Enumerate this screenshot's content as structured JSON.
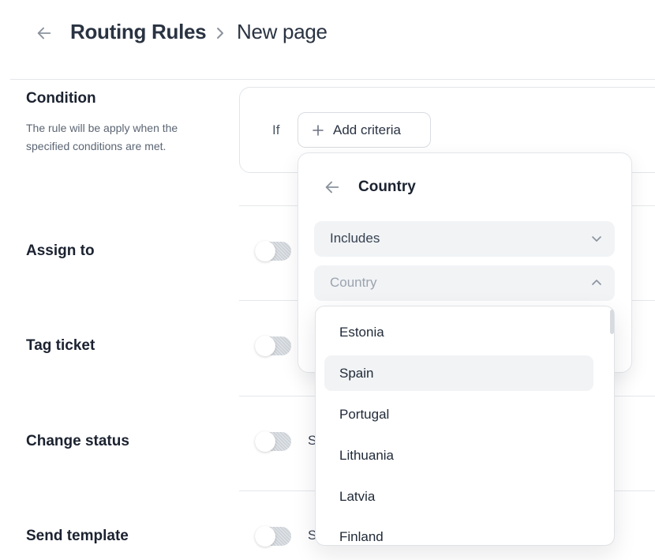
{
  "header": {
    "breadcrumb_root": "Routing Rules",
    "breadcrumb_current": "New page"
  },
  "condition": {
    "title": "Condition",
    "description": "The rule will be apply when the specified conditions are met.",
    "if_label": "If",
    "add_criteria_label": "Add criteria"
  },
  "rows": {
    "assign_to": {
      "label": "Assign to"
    },
    "tag_ticket": {
      "label": "Tag ticket"
    },
    "change_status": {
      "label": "Change status",
      "hint": "S"
    },
    "send_template": {
      "label": "Send template",
      "hint": "S"
    }
  },
  "popover": {
    "title": "Country",
    "operator": {
      "value": "Includes"
    },
    "country_select": {
      "placeholder": "Country"
    },
    "options": [
      "Estonia",
      "Spain",
      "Portugal",
      "Lithuania",
      "Latvia",
      "Finland"
    ],
    "selected_option": "Spain"
  },
  "colors": {
    "text_dark": "#1b2230",
    "text_muted": "#5b6573",
    "placeholder": "#9ca3af",
    "border": "#e2e5e9",
    "field_bg": "#f1f3f5"
  },
  "icons": {
    "back": "arrow-left-icon",
    "breadcrumb_separator": "chevron-right-icon",
    "add": "plus-icon",
    "select_closed": "chevron-down-icon",
    "select_open": "chevron-up-icon"
  }
}
